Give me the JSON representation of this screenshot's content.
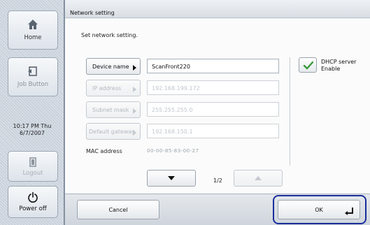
{
  "sidebar": {
    "home_label": "Home",
    "job_button_label": "Job Button",
    "clock_time": "10:17 PM Thu",
    "clock_date": "6/7/2007",
    "logout_label": "Logout",
    "power_off_label": "Power off"
  },
  "main": {
    "title": "Network setting",
    "instruction": "Set network setting.",
    "fields": [
      {
        "label": "Device name",
        "value": "ScanFront220",
        "enabled": true
      },
      {
        "label": "IP address",
        "value": "192.168.199.172",
        "enabled": false
      },
      {
        "label": "Subnet mask",
        "value": "255.255.255.0",
        "enabled": false
      },
      {
        "label": "Default gateway",
        "value": "192.168.150.1",
        "enabled": false
      }
    ],
    "mac_label": "MAC address",
    "mac_value": "00-00-85-83-00-27",
    "dhcp": {
      "line1": "DHCP server",
      "line2": "Enable",
      "checked": true
    },
    "page_indicator": "1/2"
  },
  "bottom": {
    "cancel_label": "Cancel",
    "ok_label": "OK"
  },
  "colors": {
    "check_green": "#3a9a3a",
    "focus_ring": "#1a2d9a"
  }
}
